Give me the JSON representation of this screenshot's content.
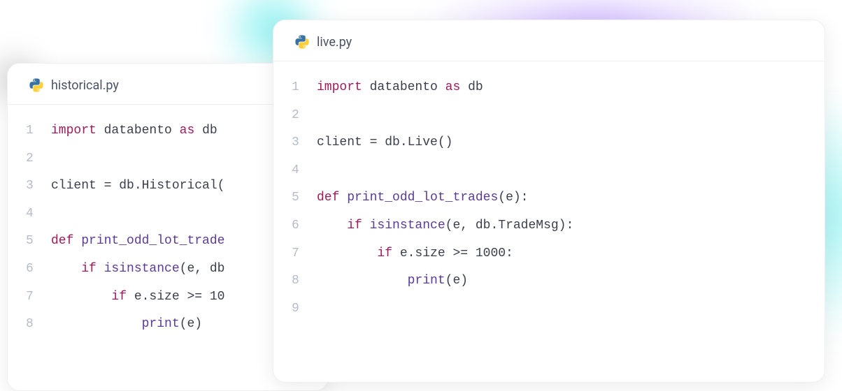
{
  "colors": {
    "python_blue": "#3772a3",
    "python_yellow": "#ffd03a",
    "keyword": "#a01a59",
    "builtin": "#5a3a9a",
    "text": "#3a3f4b",
    "gutter": "#b6bcc9"
  },
  "editors": {
    "back": {
      "filename": "historical.py",
      "lines": [
        {
          "n": "1",
          "tokens": [
            [
              "kw",
              "import "
            ],
            [
              "nm",
              "databento "
            ],
            [
              "kw",
              "as "
            ],
            [
              "nm",
              "db"
            ]
          ]
        },
        {
          "n": "2",
          "tokens": []
        },
        {
          "n": "3",
          "tokens": [
            [
              "nm",
              "client = db.Historical("
            ]
          ]
        },
        {
          "n": "4",
          "tokens": []
        },
        {
          "n": "5",
          "tokens": [
            [
              "kw",
              "def "
            ],
            [
              "fn",
              "print_odd_lot_trade"
            ]
          ]
        },
        {
          "n": "6",
          "tokens": [
            [
              "nm",
              "    "
            ],
            [
              "kw",
              "if "
            ],
            [
              "fn",
              "isinstance"
            ],
            [
              "nm",
              "(e, db"
            ]
          ]
        },
        {
          "n": "7",
          "tokens": [
            [
              "nm",
              "        "
            ],
            [
              "kw",
              "if "
            ],
            [
              "nm",
              "e.size >= 10"
            ]
          ]
        },
        {
          "n": "8",
          "tokens": [
            [
              "nm",
              "            "
            ],
            [
              "fn",
              "print"
            ],
            [
              "nm",
              "(e)"
            ]
          ]
        }
      ]
    },
    "front": {
      "filename": "live.py",
      "lines": [
        {
          "n": "1",
          "tokens": [
            [
              "kw",
              "import "
            ],
            [
              "nm",
              "databento "
            ],
            [
              "kw",
              "as "
            ],
            [
              "nm",
              "db"
            ]
          ]
        },
        {
          "n": "2",
          "tokens": []
        },
        {
          "n": "3",
          "tokens": [
            [
              "nm",
              "client = db.Live()"
            ]
          ]
        },
        {
          "n": "4",
          "tokens": []
        },
        {
          "n": "5",
          "tokens": [
            [
              "kw",
              "def "
            ],
            [
              "fn",
              "print_odd_lot_trades"
            ],
            [
              "nm",
              "(e):"
            ]
          ]
        },
        {
          "n": "6",
          "tokens": [
            [
              "nm",
              "    "
            ],
            [
              "kw",
              "if "
            ],
            [
              "fn",
              "isinstance"
            ],
            [
              "nm",
              "(e, db.TradeMsg):"
            ]
          ]
        },
        {
          "n": "7",
          "tokens": [
            [
              "nm",
              "        "
            ],
            [
              "kw",
              "if "
            ],
            [
              "nm",
              "e.size >= 1000:"
            ]
          ]
        },
        {
          "n": "8",
          "tokens": [
            [
              "nm",
              "            "
            ],
            [
              "fn",
              "print"
            ],
            [
              "nm",
              "(e)"
            ]
          ]
        },
        {
          "n": "9",
          "tokens": []
        }
      ]
    }
  }
}
